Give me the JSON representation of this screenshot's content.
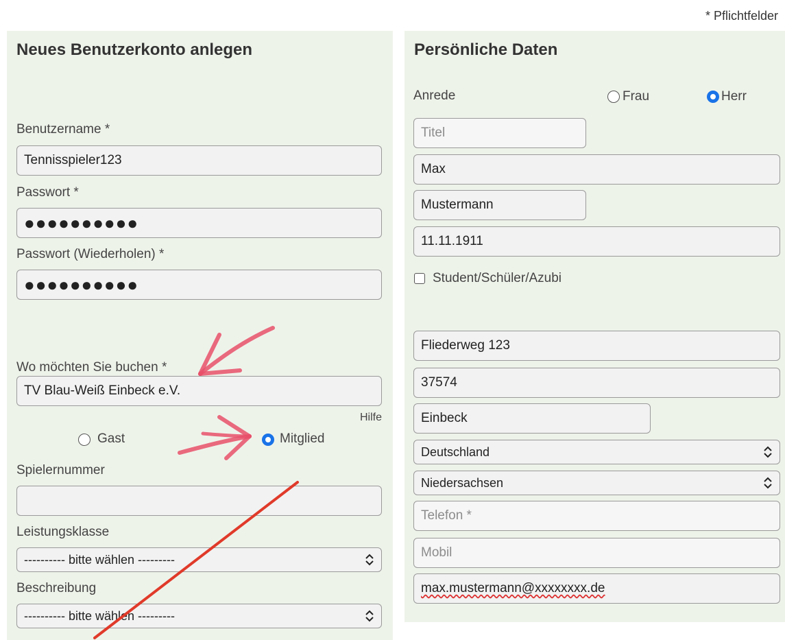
{
  "required_note": "* Pflichtfelder",
  "left": {
    "title": "Neues Benutzerkonto anlegen",
    "username_label": "Benutzername *",
    "username_value": "Tennisspieler123",
    "password_label": "Passwort *",
    "password_value": "●●●●●●●●●●",
    "password_repeat_label": "Passwort (Wiederholen) *",
    "password_repeat_value": "●●●●●●●●●●",
    "booking_label": "Wo möchten Sie buchen *",
    "booking_value": "TV Blau-Weiß Einbeck e.V.",
    "help_link": "Hilfe",
    "radio_guest": "Gast",
    "radio_member": "Mitglied",
    "player_number_label": "Spielernummer",
    "player_number_value": "",
    "performance_label": "Leistungsklasse",
    "performance_value": "---------- bitte wählen ---------",
    "description_label": "Beschreibung",
    "description_value": "---------- bitte wählen ---------"
  },
  "right": {
    "title": "Persönliche Daten",
    "salutation_label": "Anrede",
    "radio_frau": "Frau",
    "radio_herr": "Herr",
    "title_placeholder": "Titel",
    "first_name": "Max",
    "last_name": "Mustermann",
    "birthdate": "11.11.1911",
    "student_checkbox": "Student/Schüler/Azubi",
    "street": "Fliederweg 123",
    "zip": "37574",
    "city": "Einbeck",
    "country": "Deutschland",
    "state": "Niedersachsen",
    "phone_placeholder": "Telefon *",
    "mobile_placeholder": "Mobil",
    "email_value": "max.mustermann@xxxxxxxx.de"
  },
  "colors": {
    "panel_bg": "#eef3ea",
    "radio_active": "#1a73e8",
    "annotation_pink": "#e8506a",
    "annotation_red": "#e03a2a"
  }
}
